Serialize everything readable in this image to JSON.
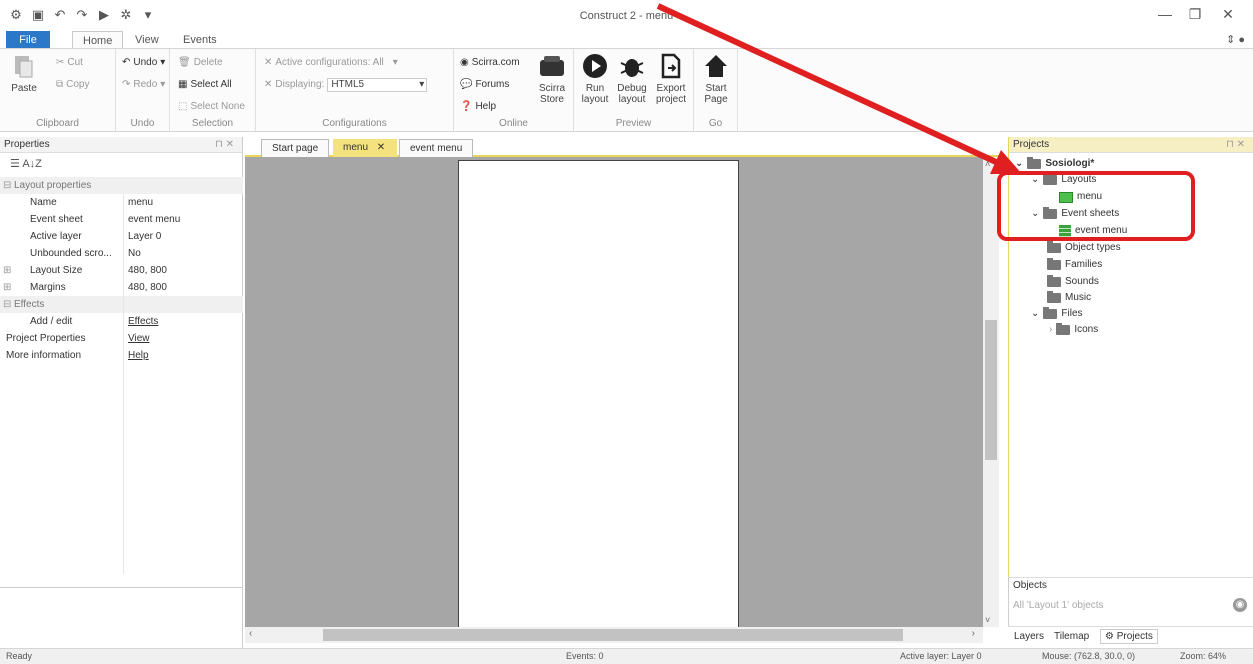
{
  "window": {
    "title": "Construct 2 - menu"
  },
  "ribbon_tabs": [
    "File",
    "Home",
    "View",
    "Events"
  ],
  "clipboard": {
    "paste": "Paste",
    "cut": "Cut",
    "copy": "Copy",
    "caption": "Clipboard"
  },
  "undo": {
    "undo": "Undo",
    "redo": "Redo",
    "caption": "Undo"
  },
  "selection": {
    "delete": "Delete",
    "select_all": "Select All",
    "select_none": "Select None",
    "caption": "Selection"
  },
  "configurations": {
    "active": "Active configurations: All",
    "displaying_label": "Displaying:",
    "displaying_value": "HTML5",
    "caption": "Configurations"
  },
  "online": {
    "scirra": "Scirra.com",
    "forums": "Forums",
    "help": "Help",
    "store": "Scirra Store",
    "caption": "Online"
  },
  "preview": {
    "run": "Run layout",
    "debug": "Debug layout",
    "export": "Export project",
    "caption": "Preview"
  },
  "go": {
    "start": "Start Page",
    "caption": "Go"
  },
  "properties": {
    "title": "Properties",
    "sort_az": "A↓Z",
    "layout_header": "Layout properties",
    "rows": [
      {
        "k": "Name",
        "v": "menu"
      },
      {
        "k": "Event sheet",
        "v": "event menu"
      },
      {
        "k": "Active layer",
        "v": "Layer 0"
      },
      {
        "k": "Unbounded scro...",
        "v": "No"
      },
      {
        "k": "Layout Size",
        "v": "480, 800"
      },
      {
        "k": "Margins",
        "v": "480, 800"
      }
    ],
    "effects_header": "Effects",
    "add_edit": "Add / edit",
    "effects_link": "Effects",
    "project_properties": "Project Properties",
    "view_link": "View",
    "more_information": "More information",
    "help_link": "Help"
  },
  "doc_tabs": [
    "Start page",
    "menu",
    "event menu"
  ],
  "projects": {
    "title": "Projects",
    "root": "Sosiologi*",
    "layouts": "Layouts",
    "layout_menu": "menu",
    "event_sheets": "Event sheets",
    "event_menu": "event menu",
    "object_types": "Object types",
    "families": "Families",
    "sounds": "Sounds",
    "music": "Music",
    "files": "Files",
    "icons": "Icons"
  },
  "objects": {
    "title": "Objects",
    "filter": "All 'Layout 1' objects"
  },
  "panel_switch": [
    "Layers",
    "Tilemap",
    "Projects"
  ],
  "status": {
    "ready": "Ready",
    "events": "Events: 0",
    "active_layer": "Active layer: Layer 0",
    "mouse": "Mouse: (762.8, 30.0, 0)",
    "zoom": "Zoom: 64%"
  },
  "colors": {
    "accent_yellow": "#e8d55a",
    "file_tab": "#2b77c8",
    "annotation_red": "#e02020"
  }
}
